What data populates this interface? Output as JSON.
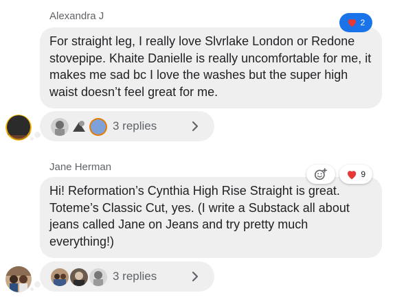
{
  "comments": [
    {
      "author": "Alexandra J",
      "text": "For straight leg, I really love Slvrlake London or Redone stovepipe. Khaite Danielle is really uncomfortable for me, it makes me sad bc I love the washes but the super high waist doesn’t feel great for me.",
      "reaction_count": "2",
      "replies_label": "3 replies"
    },
    {
      "author": "Jane Herman",
      "text": "Hi! Reformation’s Cynthia High Rise Straight is great. Toteme’s Classic Cut, yes. (I write a Substack all about jeans called Jane on Jeans and try pretty much everything!)",
      "reaction_count": "9",
      "replies_label": "3 replies"
    }
  ],
  "icons": {
    "reaction": "heart-icon",
    "add_reaction": "add-reaction-icon",
    "replies_expand": "chevron-right-icon"
  },
  "colors": {
    "bubble": "#efefef",
    "active_reaction": "#1a73e8",
    "heart": "#e53935",
    "meta_text": "#5f6368"
  }
}
